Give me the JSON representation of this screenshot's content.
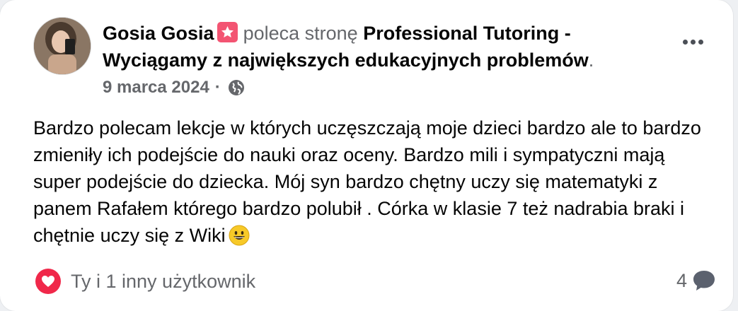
{
  "post": {
    "author": "Gosia Gosia",
    "verb": "poleca stronę",
    "page_name": "Professional Tutoring - Wyciągamy z największych edukacyjnych problemów",
    "trailing_dot": ".",
    "date": "9 marca 2024",
    "separator": "·",
    "body_line_1": "Bardzo polecam lekcje w których uczęszczają moje dzieci bardzo ale to bardzo",
    "body_line_2": "zmieniły ich podejście do nauki oraz oceny. Bardzo mili i sympatyczni mają",
    "body_line_3": "super podejście do dziecka. Mój syn bardzo chętny uczy się matematyki z",
    "body_line_4": "panem Rafałem którego bardzo polubił . Córka w klasie 7 też nadrabia braki i",
    "body_line_5": "chętnie uczy się z Wiki"
  },
  "footer": {
    "reactions_text": "Ty i 1 inny użytkownik",
    "comment_count": "4"
  },
  "icons": {
    "badge": "recommendation-star-icon",
    "privacy": "globe-icon",
    "more": "more-options-icon",
    "reaction": "heart-reaction-icon",
    "comment": "comment-bubble-icon",
    "emoji": "grinning-face-emoji"
  },
  "colors": {
    "badge": "#f35472",
    "heart": "#f0284a",
    "secondary_text": "#65676b",
    "primary_text": "#050505"
  }
}
